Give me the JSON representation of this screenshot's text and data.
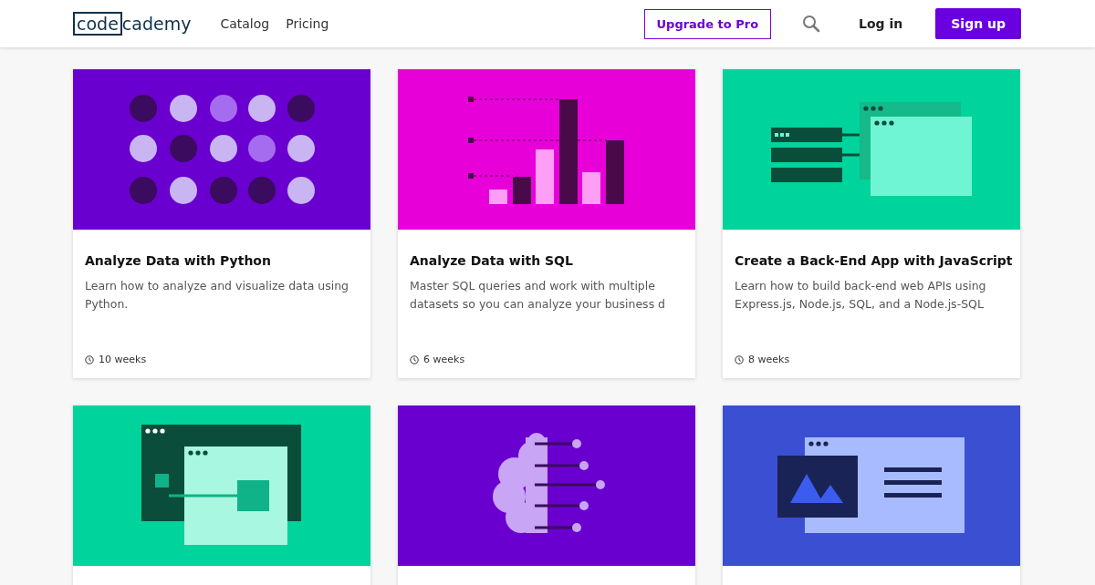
{
  "header": {
    "logo": {
      "boxed": "code",
      "rest": "cademy"
    },
    "nav": [
      "Catalog",
      "Pricing"
    ],
    "upgrade_button": "Upgrade to Pro",
    "login_link": "Log in",
    "signup_button": "Sign up"
  },
  "cards": [
    {
      "art": {
        "kind": "dots",
        "color": "#6a00cf"
      },
      "title": "Analyze Data with Python",
      "description": "Learn how to analyze and visualize data using Python.",
      "duration": "10 weeks"
    },
    {
      "art": {
        "kind": "bars",
        "color": "#e800d8"
      },
      "title": "Analyze Data with SQL",
      "description": "Master SQL queries and work with multiple datasets so you can analyze your business d",
      "duration": "6 weeks"
    },
    {
      "art": {
        "kind": "server",
        "color": "#00d39c"
      },
      "title": "Create a Back-End App with JavaScript",
      "description": "Learn how to build back-end web APIs using Express.js, Node.js, SQL, and a Node.js-SQL",
      "duration": "8 weeks"
    },
    {
      "art": {
        "kind": "windows",
        "color": "#00d39c"
      }
    },
    {
      "art": {
        "kind": "brain",
        "color": "#6a00cf"
      }
    },
    {
      "art": {
        "kind": "image-page",
        "color": "#3a4fd2"
      }
    }
  ]
}
